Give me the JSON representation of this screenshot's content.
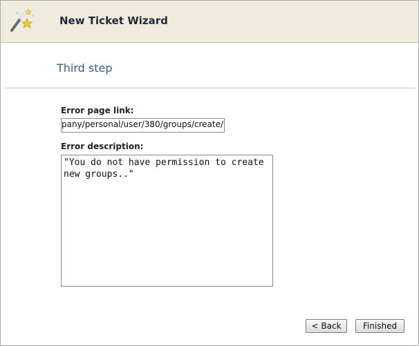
{
  "header": {
    "title": "New Ticket Wizard",
    "icon": "magic-wand-icon"
  },
  "step": {
    "title": "Third step"
  },
  "form": {
    "error_link_label": "Error page link:",
    "error_link_value": "pany/personal/user/380/groups/create/",
    "error_description_label": "Error description:",
    "error_description_value": "\"You do not have permission to create\nnew groups..\""
  },
  "buttons": {
    "back_label": "< Back",
    "finish_label": "Finished"
  },
  "colors": {
    "header_bg": "#efebdd",
    "step_title": "#2f5e8a"
  }
}
